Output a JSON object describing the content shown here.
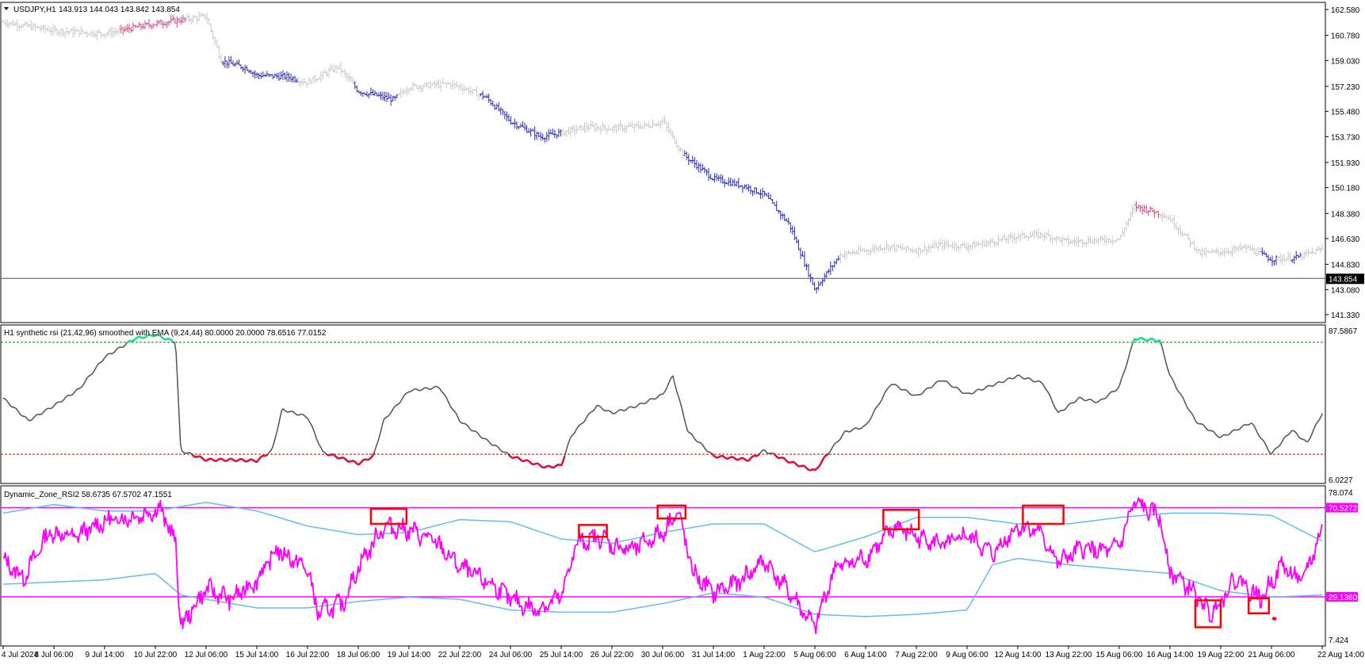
{
  "colors": {
    "background": "#ffffff",
    "axis": "#000000",
    "candle_up_gray": "#c8c8c8",
    "candle_blue": "#2b2bb5",
    "candle_pink": "#d4448a",
    "rsi_gray": "#555555",
    "rsi_red": "#dc143c",
    "rsi_green": "#22dd88",
    "level_green": "#008000",
    "level_red": "#cc0000",
    "dz_magenta": "#ff00ff",
    "dz_band": "#66bbee",
    "marker_red": "#ff0000"
  },
  "main_panel": {
    "symbol_label": "USDJPY,H1",
    "ohlc_label": "143.913 144.043 143.842 143.854",
    "price_ticks": [
      "162.580",
      "160.780",
      "159.030",
      "157.230",
      "155.480",
      "153.730",
      "151.930",
      "150.180",
      "148.380",
      "146.630",
      "144.830",
      "143.080",
      "141.330"
    ],
    "price_tick_values": [
      162.58,
      160.78,
      159.03,
      157.23,
      155.48,
      153.73,
      151.93,
      150.18,
      148.38,
      146.63,
      144.83,
      143.08,
      141.33
    ],
    "ylim": [
      141.0,
      162.8
    ],
    "current_price": "143.854",
    "current_price_value": 143.854
  },
  "rsi_panel": {
    "title": "H1 synthetic rsi (21,42,96) smoothed with EMA (9,24,44) 80.0000 20.0000 78.6516 77.0152",
    "top_tick": "87.5867",
    "bottom_tick": "6.0227",
    "ylim": [
      6.0227,
      87.5867
    ],
    "upper_level": 80,
    "lower_level": 20
  },
  "dz_panel": {
    "title": "Dynamic_Zone_RSI2 58.6735 67.5702 47.1551",
    "top_tick": "78.074",
    "bottom_tick": "7.424",
    "ylim": [
      7.424,
      78.074
    ],
    "upper_label": "70.5272",
    "upper_value": 70.5272,
    "lower_label": "29.1360",
    "lower_value": 29.136
  },
  "x_axis": {
    "labels": [
      "4 Jul 2024",
      "8 Jul 06:00",
      "9 Jul 14:00",
      "10 Jul 22:00",
      "12 Jul 06:00",
      "15 Jul 14:00",
      "16 Jul 22:00",
      "18 Jul 06:00",
      "19 Jul 14:00",
      "22 Jul 22:00",
      "24 Jul 06:00",
      "25 Jul 14:00",
      "26 Jul 22:00",
      "30 Jul 06:00",
      "31 Jul 14:00",
      "1 Aug 22:00",
      "5 Aug 06:00",
      "6 Aug 14:00",
      "7 Aug 22:00",
      "9 Aug 06:00",
      "12 Aug 14:00",
      "13 Aug 22:00",
      "15 Aug 06:00",
      "16 Aug 14:00",
      "19 Aug 22:00",
      "21 Aug 06:00",
      "22 Aug 14:00"
    ]
  },
  "chart_data": {
    "type": "line",
    "x_tick_labels": [
      "4 Jul 2024",
      "8 Jul 06:00",
      "9 Jul 14:00",
      "10 Jul 22:00",
      "12 Jul 06:00",
      "15 Jul 14:00",
      "16 Jul 22:00",
      "18 Jul 06:00",
      "19 Jul 14:00",
      "22 Jul 22:00",
      "24 Jul 06:00",
      "25 Jul 14:00",
      "26 Jul 22:00",
      "30 Jul 06:00",
      "31 Jul 14:00",
      "1 Aug 22:00",
      "5 Aug 06:00",
      "6 Aug 14:00",
      "7 Aug 22:00",
      "9 Aug 06:00",
      "12 Aug 14:00",
      "13 Aug 22:00",
      "15 Aug 06:00",
      "16 Aug 14:00",
      "19 Aug 22:00",
      "21 Aug 06:00",
      "22 Aug 14:00"
    ],
    "price_series": {
      "points": [
        [
          0,
          161.7
        ],
        [
          1,
          161.1
        ],
        [
          2,
          160.9
        ],
        [
          3,
          161.6
        ],
        [
          4,
          162.1
        ],
        [
          4.3,
          159.0
        ],
        [
          4.8,
          158.5
        ],
        [
          5,
          158.0
        ],
        [
          5.6,
          157.9
        ],
        [
          6,
          157.5
        ],
        [
          6.6,
          158.6
        ],
        [
          7,
          156.9
        ],
        [
          7.7,
          156.3
        ],
        [
          8,
          157.2
        ],
        [
          8.8,
          157.4
        ],
        [
          9,
          157.2
        ],
        [
          9.5,
          156.5
        ],
        [
          10,
          154.8
        ],
        [
          10.6,
          153.7
        ],
        [
          11,
          154.0
        ],
        [
          11.5,
          154.4
        ],
        [
          12,
          154.3
        ],
        [
          12.7,
          154.5
        ],
        [
          13,
          154.8
        ],
        [
          13.4,
          152.5
        ],
        [
          14,
          150.8
        ],
        [
          14.6,
          150.3
        ],
        [
          15,
          149.7
        ],
        [
          15.5,
          147.6
        ],
        [
          16,
          143.1
        ],
        [
          16.5,
          145.5
        ],
        [
          17,
          145.8
        ],
        [
          17.4,
          146.1
        ],
        [
          18,
          145.8
        ],
        [
          18.5,
          146.2
        ],
        [
          19,
          146.1
        ],
        [
          19.5,
          146.4
        ],
        [
          20,
          146.8
        ],
        [
          20.5,
          146.9
        ],
        [
          21,
          146.4
        ],
        [
          21.5,
          146.5
        ],
        [
          22,
          146.6
        ],
        [
          22.3,
          148.9
        ],
        [
          22.8,
          148.4
        ],
        [
          23,
          148.0
        ],
        [
          23.6,
          145.6
        ],
        [
          24,
          145.7
        ],
        [
          24.5,
          146.0
        ],
        [
          25,
          145.2
        ],
        [
          25.5,
          145.3
        ],
        [
          26,
          145.9
        ]
      ],
      "color_runs": [
        {
          "from": 0,
          "to": 2.3,
          "color": "gray"
        },
        {
          "from": 2.3,
          "to": 3.6,
          "color": "pink"
        },
        {
          "from": 4.3,
          "to": 5.8,
          "color": "blue"
        },
        {
          "from": 5.8,
          "to": 6.9,
          "color": "gray"
        },
        {
          "from": 6.9,
          "to": 7.8,
          "color": "blue"
        },
        {
          "from": 7.8,
          "to": 9.4,
          "color": "gray"
        },
        {
          "from": 9.4,
          "to": 11.0,
          "color": "blue"
        },
        {
          "from": 11.0,
          "to": 13.4,
          "color": "gray"
        },
        {
          "from": 13.4,
          "to": 16.5,
          "color": "blue"
        },
        {
          "from": 16.5,
          "to": 22.3,
          "color": "gray"
        },
        {
          "from": 22.3,
          "to": 22.8,
          "color": "pink"
        },
        {
          "from": 22.8,
          "to": 24.8,
          "color": "gray"
        },
        {
          "from": 24.8,
          "to": 25.1,
          "color": "blue"
        },
        {
          "from": 25.1,
          "to": 25.4,
          "color": "gray"
        },
        {
          "from": 25.4,
          "to": 25.6,
          "color": "blue"
        },
        {
          "from": 25.6,
          "to": 26.0,
          "color": "gray"
        }
      ]
    },
    "rsi_series": {
      "points": [
        [
          0,
          50.0
        ],
        [
          0.5,
          38.0
        ],
        [
          1,
          46.0
        ],
        [
          1.5,
          55.0
        ],
        [
          2,
          72.0
        ],
        [
          2.6,
          82.0
        ],
        [
          3,
          84.0
        ],
        [
          3.4,
          80.0
        ],
        [
          3.5,
          22.0
        ],
        [
          4,
          17.0
        ],
        [
          4.5,
          17.0
        ],
        [
          5,
          16.5
        ],
        [
          5.3,
          22.0
        ],
        [
          5.5,
          44.0
        ],
        [
          6,
          40.0
        ],
        [
          6.3,
          21.0
        ],
        [
          7,
          15.0
        ],
        [
          7.3,
          19.0
        ],
        [
          7.5,
          38.0
        ],
        [
          8,
          54.0
        ],
        [
          8.6,
          56.0
        ],
        [
          9,
          38.0
        ],
        [
          9.5,
          28.0
        ],
        [
          10,
          19.0
        ],
        [
          10.7,
          13.0
        ],
        [
          11,
          14.0
        ],
        [
          11.2,
          30.0
        ],
        [
          11.7,
          46.0
        ],
        [
          12,
          42.0
        ],
        [
          12.5,
          46.0
        ],
        [
          13,
          52.0
        ],
        [
          13.2,
          62.0
        ],
        [
          13.5,
          32.0
        ],
        [
          14,
          19.0
        ],
        [
          14.7,
          17.0
        ],
        [
          15,
          22.0
        ],
        [
          15.5,
          16.0
        ],
        [
          16,
          11.0
        ],
        [
          16.3,
          22.0
        ],
        [
          16.6,
          32.0
        ],
        [
          17,
          35.0
        ],
        [
          17.5,
          58.0
        ],
        [
          18,
          51.0
        ],
        [
          18.5,
          60.0
        ],
        [
          19,
          52.0
        ],
        [
          19.5,
          57.0
        ],
        [
          20,
          62.0
        ],
        [
          20.5,
          58.0
        ],
        [
          20.8,
          42.0
        ],
        [
          21.2,
          50.0
        ],
        [
          21.6,
          48.0
        ],
        [
          22,
          56.0
        ],
        [
          22.3,
          82.0
        ],
        [
          22.8,
          81.0
        ],
        [
          23,
          62.0
        ],
        [
          23.5,
          38.0
        ],
        [
          24,
          29.0
        ],
        [
          24.6,
          37.0
        ],
        [
          25,
          20.0
        ],
        [
          25.4,
          33.0
        ],
        [
          25.7,
          26.0
        ],
        [
          26,
          42.0
        ]
      ]
    },
    "dz_series": {
      "rsi_points": [
        [
          0,
          46.0
        ],
        [
          0.4,
          38.0
        ],
        [
          0.9,
          59.0
        ],
        [
          1.4,
          57.0
        ],
        [
          2,
          64.0
        ],
        [
          2.7,
          67.0
        ],
        [
          3.1,
          70.0
        ],
        [
          3.4,
          54.0
        ],
        [
          3.5,
          15.0
        ],
        [
          4,
          33.0
        ],
        [
          4.5,
          28.0
        ],
        [
          5,
          37.0
        ],
        [
          5.4,
          51.0
        ],
        [
          6,
          42.0
        ],
        [
          6.2,
          22.0
        ],
        [
          6.7,
          26.0
        ],
        [
          7,
          43.0
        ],
        [
          7.5,
          62.0
        ],
        [
          8,
          60.0
        ],
        [
          8.5,
          55.0
        ],
        [
          9,
          43.0
        ],
        [
          9.7,
          34.0
        ],
        [
          10,
          28.0
        ],
        [
          10.5,
          23.0
        ],
        [
          11,
          29.0
        ],
        [
          11.3,
          54.0
        ],
        [
          11.8,
          57.0
        ],
        [
          12,
          53.0
        ],
        [
          12.4,
          51.0
        ],
        [
          13,
          59.0
        ],
        [
          13.3,
          69.0
        ],
        [
          13.6,
          40.0
        ],
        [
          14,
          31.0
        ],
        [
          14.5,
          36.0
        ],
        [
          15,
          46.0
        ],
        [
          15.5,
          31.0
        ],
        [
          16,
          15.0
        ],
        [
          16.4,
          43.0
        ],
        [
          17,
          47.0
        ],
        [
          17.6,
          62.0
        ],
        [
          18,
          57.0
        ],
        [
          18.6,
          53.0
        ],
        [
          19,
          58.0
        ],
        [
          19.5,
          49.0
        ],
        [
          20,
          62.0
        ],
        [
          20.4,
          60.0
        ],
        [
          20.8,
          45.0
        ],
        [
          21.3,
          52.0
        ],
        [
          21.7,
          50.0
        ],
        [
          22,
          53.0
        ],
        [
          22.3,
          73.0
        ],
        [
          22.8,
          66.0
        ],
        [
          23,
          41.0
        ],
        [
          23.4,
          33.0
        ],
        [
          23.8,
          21.0
        ],
        [
          24.3,
          38.0
        ],
        [
          24.8,
          28.0
        ],
        [
          25.2,
          44.0
        ],
        [
          25.6,
          36.0
        ],
        [
          26,
          60.0
        ]
      ],
      "band_upper_points": [
        [
          0,
          68.0
        ],
        [
          1,
          72.0
        ],
        [
          2,
          69.0
        ],
        [
          3,
          69.0
        ],
        [
          4,
          73.0
        ],
        [
          5,
          69.0
        ],
        [
          6,
          62.0
        ],
        [
          7,
          58.0
        ],
        [
          8,
          59.0
        ],
        [
          9,
          65.0
        ],
        [
          10,
          64.0
        ],
        [
          11,
          56.0
        ],
        [
          12,
          54.0
        ],
        [
          13,
          59.0
        ],
        [
          14,
          63.0
        ],
        [
          15,
          63.0
        ],
        [
          16,
          50.0
        ],
        [
          17,
          57.0
        ],
        [
          18,
          66.0
        ],
        [
          19,
          66.0
        ],
        [
          20,
          63.0
        ],
        [
          21,
          63.0
        ],
        [
          22,
          66.0
        ],
        [
          23,
          68.0
        ],
        [
          24,
          68.0
        ],
        [
          25,
          67.0
        ],
        [
          26,
          55.0
        ]
      ],
      "band_lower_points": [
        [
          0,
          35.0
        ],
        [
          1,
          36.0
        ],
        [
          2,
          37.0
        ],
        [
          3,
          40.0
        ],
        [
          3.5,
          30.0
        ],
        [
          4,
          28.0
        ],
        [
          5,
          24.0
        ],
        [
          6,
          24.0
        ],
        [
          7,
          27.0
        ],
        [
          8,
          29.0
        ],
        [
          9,
          28.0
        ],
        [
          10,
          23.0
        ],
        [
          11,
          22.0
        ],
        [
          12,
          22.0
        ],
        [
          13,
          26.0
        ],
        [
          14,
          31.0
        ],
        [
          15,
          29.0
        ],
        [
          16,
          21.0
        ],
        [
          17,
          20.0
        ],
        [
          18,
          21.0
        ],
        [
          19,
          23.0
        ],
        [
          19.5,
          44.0
        ],
        [
          20,
          47.0
        ],
        [
          21,
          44.0
        ],
        [
          22,
          42.0
        ],
        [
          23,
          40.0
        ],
        [
          24,
          32.0
        ],
        [
          25,
          29.0
        ],
        [
          26,
          30.0
        ]
      ],
      "marker_boxes": [
        [
          7.25,
          7.95,
          63.0,
          70.0
        ],
        [
          11.35,
          11.9,
          57.0,
          62.5
        ],
        [
          12.9,
          13.45,
          65.5,
          71.5
        ],
        [
          17.35,
          18.05,
          60.5,
          69.5
        ],
        [
          20.1,
          20.9,
          63.0,
          71.5
        ],
        [
          23.5,
          24.0,
          15.0,
          27.5
        ],
        [
          24.55,
          24.95,
          21.5,
          28.5
        ]
      ],
      "marker_dot": [
        25.05,
        19.0
      ]
    }
  }
}
